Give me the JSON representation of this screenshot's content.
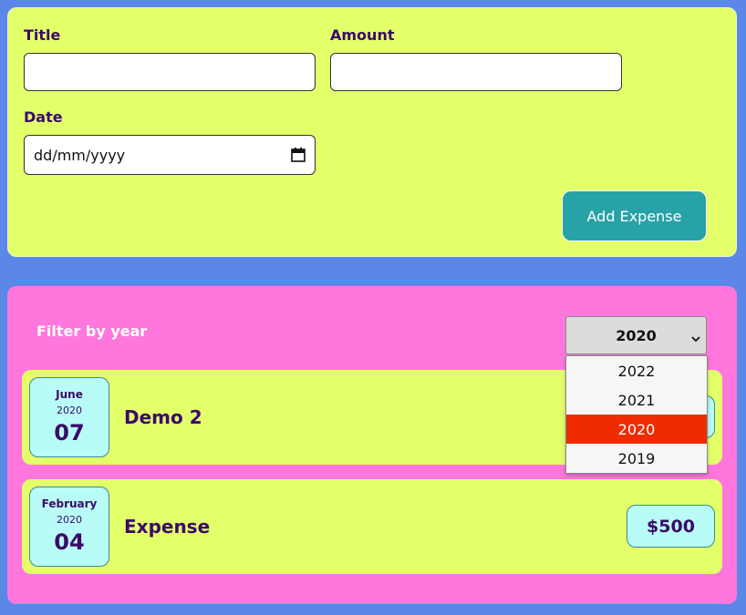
{
  "form": {
    "title_label": "Title",
    "title_value": "",
    "amount_label": "Amount",
    "amount_value": "",
    "date_label": "Date",
    "date_placeholder": "dd/mm/yyyy",
    "add_button_label": "Add Expense"
  },
  "filter": {
    "label": "Filter by year",
    "selected_year": "2020",
    "options": [
      {
        "label": "2022",
        "selected": false
      },
      {
        "label": "2021",
        "selected": false
      },
      {
        "label": "2020",
        "selected": true
      },
      {
        "label": "2019",
        "selected": false
      }
    ]
  },
  "expenses": [
    {
      "month": "June",
      "year": "2020",
      "day": "07",
      "title": "Demo 2",
      "amount": ""
    },
    {
      "month": "February",
      "year": "2020",
      "day": "04",
      "title": "Expense",
      "amount": "$500"
    }
  ],
  "colors": {
    "page_bg": "#5b87e8",
    "form_bg": "#e3ff6a",
    "list_bg": "#ff77dd",
    "accent_button": "#27a2a6",
    "date_box_bg": "#b9fbf7",
    "text_primary": "#3a0a6b",
    "dropdown_selected": "#ee2c00"
  },
  "icons": {
    "date_picker": "calendar-icon",
    "select_arrow": "chevron-down-icon"
  }
}
